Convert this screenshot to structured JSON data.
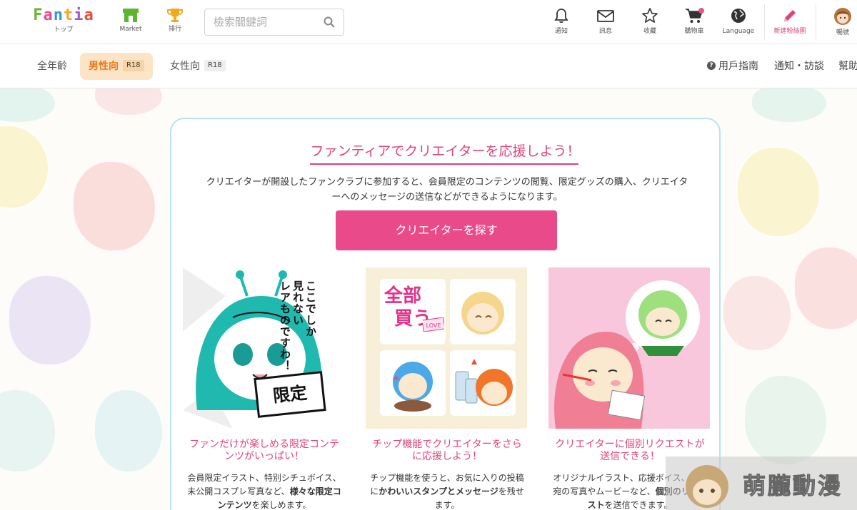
{
  "header": {
    "logo": {
      "text": "Fantia",
      "sub": "トップ"
    },
    "nav": [
      {
        "label": "Market",
        "icon": "shop-icon",
        "color": "#5cb531"
      },
      {
        "label": "排行",
        "icon": "trophy-icon",
        "color": "#f2a81d"
      }
    ],
    "search": {
      "placeholder": "檢索關鍵詞",
      "value": ""
    },
    "icons": [
      {
        "label": "通知",
        "icon": "bell-icon"
      },
      {
        "label": "訊息",
        "icon": "envelope-icon"
      },
      {
        "label": "收藏",
        "icon": "star-icon"
      },
      {
        "label": "購物車",
        "icon": "cart-icon"
      },
      {
        "label": "Language",
        "icon": "globe-icon"
      },
      {
        "label": "新建粉絲團",
        "icon": "pencil-icon",
        "color": "#e0447a"
      },
      {
        "label": "暢號",
        "icon": "avatar"
      }
    ]
  },
  "subnav": {
    "tabs": [
      {
        "label": "全年齡",
        "badge": ""
      },
      {
        "label": "男性向",
        "badge": "R18",
        "active": true
      },
      {
        "label": "女性向",
        "badge": "R18"
      }
    ],
    "links": [
      {
        "label": "用戶指南",
        "icon": "question-icon"
      },
      {
        "label": "通知・訪談"
      },
      {
        "label": "幫助"
      }
    ]
  },
  "main": {
    "title": "ファンティアでクリエイターを応援しよう！",
    "description": "クリエイターが開設したファンクラブに参加すると、会員限定のコンテンツの閲覧、限定グッズの購入、クリエイターへのメッセージの送信などができるようになります。",
    "cta": "クリエイターを探す",
    "features": [
      {
        "title": "ファンだけが楽しめる限定コンテンツがいっぱい！",
        "desc_pre": "会員限定イラスト、特別シチュボイス、未公開コスプレ写真など、",
        "desc_bold": "様々な限定コンテンツ",
        "desc_post": "を楽しめます。",
        "image_text": [
          "ここでしか",
          "見れない",
          "レアものですわ！"
        ],
        "stamp": "限定"
      },
      {
        "title": "チップ機能でクリエイターをさらに応援しよう！",
        "desc_pre": "チップ機能を使うと、お気に入りの投稿に",
        "desc_bold": "かわいいスタンプとメッセージ",
        "desc_post": "を残せます。",
        "image_text": [
          "全部",
          "買う"
        ],
        "love": "LOVE"
      },
      {
        "title": "クリエイターに個別リクエストが送信できる！",
        "desc_pre": "オリジナルイラスト、応援ボイス、自分宛の写真やムービーなど、",
        "desc_bold": "個別のリクエスト",
        "desc_post": "を送信できます。"
      }
    ]
  },
  "watermark": "萌朧動漫",
  "colors": {
    "accent": "#e0447a",
    "cta": "#e94b8a",
    "tab_active_bg": "#fde4c6",
    "tab_active_text": "#e8771a",
    "card_border": "#b9e4ea"
  }
}
